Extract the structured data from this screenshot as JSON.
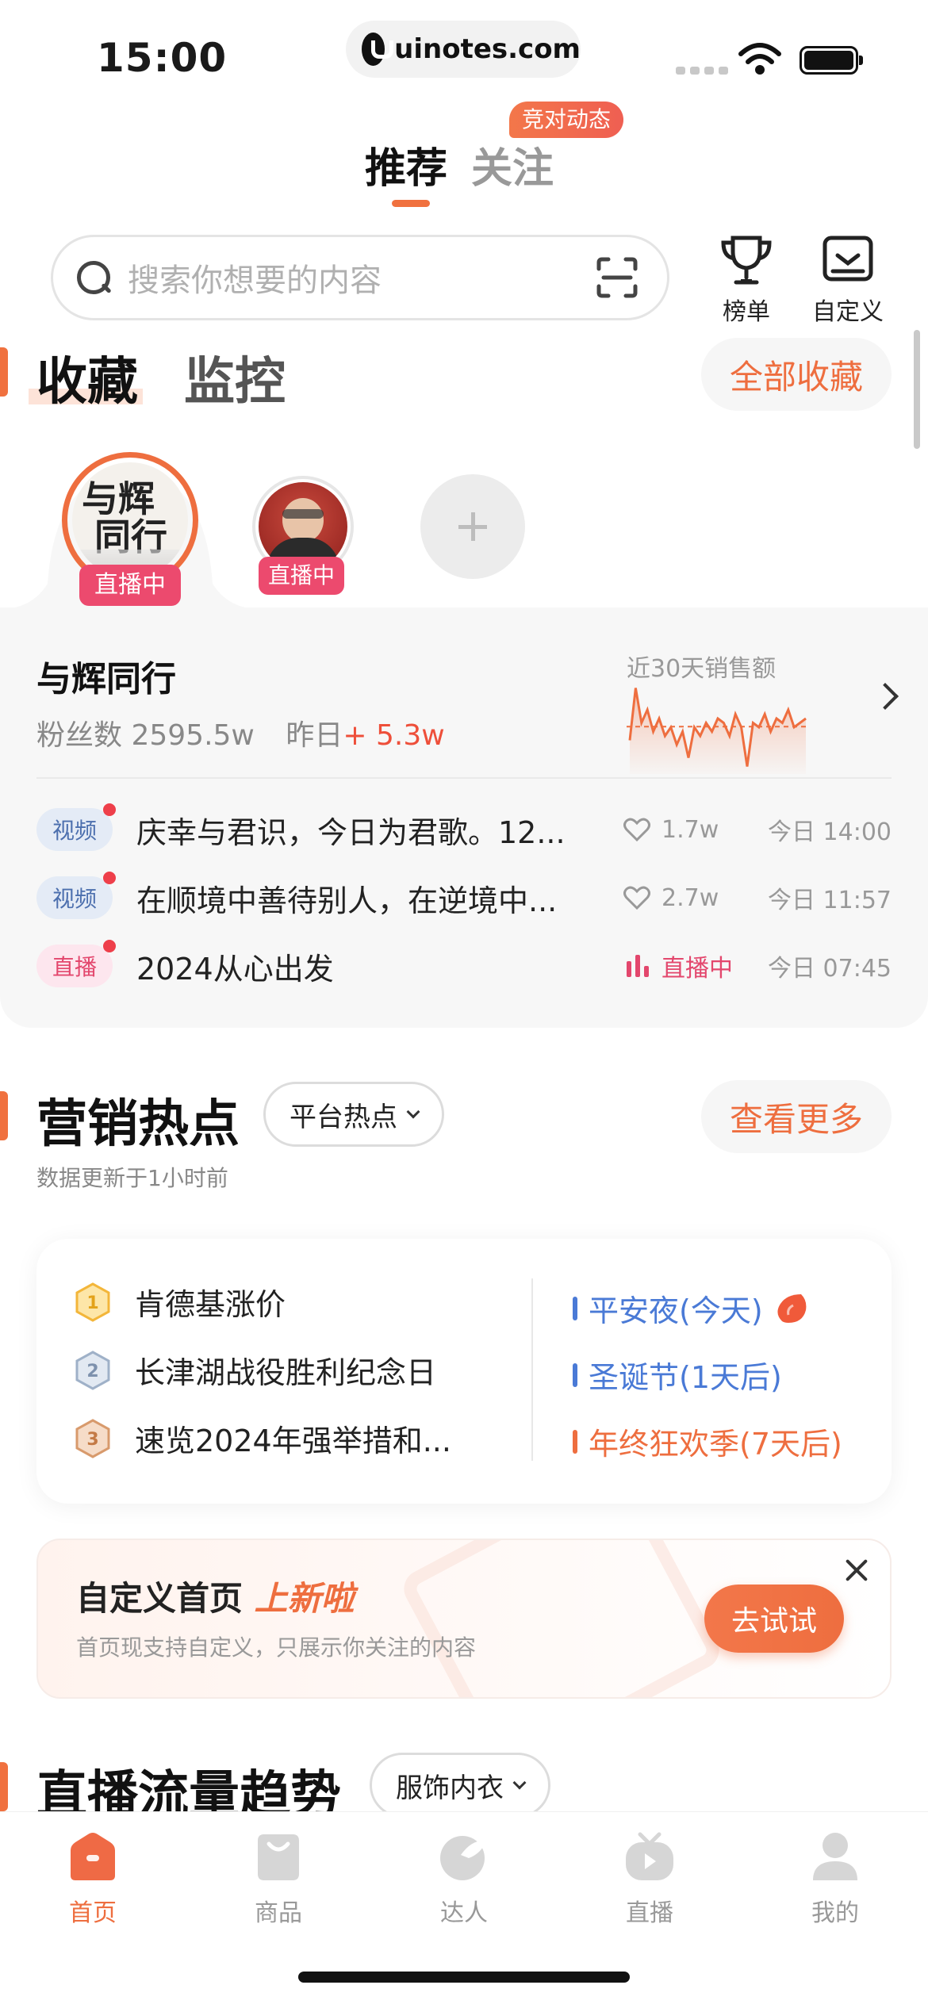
{
  "status_bar": {
    "time": "15:00",
    "url": "uinotes.com"
  },
  "top_tabs": {
    "recommend": "推荐",
    "follow": "关注",
    "badge": "竞对动态"
  },
  "search": {
    "placeholder": "搜索你想要的内容"
  },
  "top_buttons": {
    "ranking": "榜单",
    "customize": "自定义"
  },
  "collect": {
    "tab_active": "收藏",
    "tab_inactive": "监控",
    "all_button": "全部收藏",
    "avatars": [
      {
        "name": "与辉同行",
        "status": "直播中"
      },
      {
        "name": "",
        "status": "直播中"
      }
    ],
    "avatar_text_line1": "与辉",
    "avatar_text_line2": "同行"
  },
  "info": {
    "name": "与辉同行",
    "fans_label": "粉丝数",
    "fans_value": "2595.5w",
    "yesterday_label": "昨日",
    "yesterday_value": "+ 5.3w",
    "sales_label": "近30天销售额",
    "sparkline": [
      0.35,
      0.95,
      0.55,
      0.7,
      0.45,
      0.6,
      0.4,
      0.5,
      0.3,
      0.45,
      0.15,
      0.5,
      0.4,
      0.55,
      0.45,
      0.6,
      0.55,
      0.4,
      0.65,
      0.5,
      0.05,
      0.55,
      0.5,
      0.65,
      0.45,
      0.6,
      0.55,
      0.7,
      0.5,
      0.55,
      0.6
    ]
  },
  "feed": [
    {
      "tag": "视频",
      "title": "庆幸与君识，今日为君歌。12...",
      "likes": "1.7w",
      "time": "今日 14:00"
    },
    {
      "tag": "视频",
      "title": "在顺境中善待别人，在逆境中...",
      "likes": "2.7w",
      "time": "今日 11:57"
    },
    {
      "tag": "直播",
      "title": "2024从心出发",
      "live_status": "直播中",
      "time": "今日 07:45"
    }
  ],
  "marketing": {
    "title": "营销热点",
    "dropdown": "平台热点",
    "more": "查看更多",
    "updated": "数据更新于1小时前",
    "hot_list": [
      {
        "rank": "1",
        "text": "肯德基涨价"
      },
      {
        "rank": "2",
        "text": "长津湖战役胜利纪念日"
      },
      {
        "rank": "3",
        "text": "速览2024年强举措和..."
      }
    ],
    "events": [
      {
        "text": "平安夜(今天)",
        "color": "#4a7ad6"
      },
      {
        "text": "圣诞节(1天后)",
        "color": "#4a7ad6"
      },
      {
        "text": "年终狂欢季(7天后)",
        "color": "#ee6e3f"
      }
    ]
  },
  "banner": {
    "title": "自定义首页",
    "title_highlight": "上新啦",
    "subtitle": "首页现支持自定义，只展示你关注的内容",
    "button": "去试试"
  },
  "live_trend": {
    "title": "直播流量趋势",
    "dropdown": "服饰内衣"
  },
  "bottom_nav": [
    "首页",
    "商品",
    "达人",
    "直播",
    "我的"
  ],
  "colors": {
    "accent": "#ee6e3f",
    "live": "#e3476d",
    "blue": "#4a7ad6"
  }
}
